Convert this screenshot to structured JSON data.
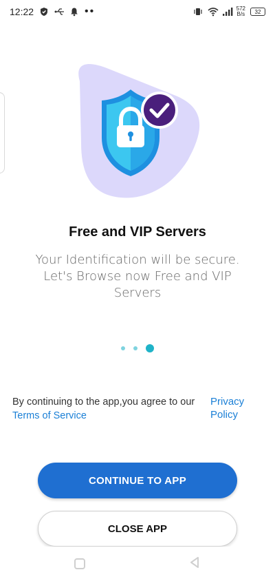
{
  "status_bar": {
    "time": "12:22",
    "net_speed_value": "572",
    "net_speed_unit": "B/s",
    "battery": "32"
  },
  "icons": {
    "status_left": [
      "shield-check-icon",
      "usb-icon",
      "bell-icon",
      "more-dots-icon"
    ],
    "status_right": [
      "vibrate-icon",
      "wifi-icon",
      "signal-icon",
      "battery-icon"
    ]
  },
  "onboarding": {
    "title": "Free and VIP Servers",
    "subtitle": "Your Identification will be secure. Let's Browse now Free and VIP Servers",
    "page_count": 3,
    "current_page": 3
  },
  "terms": {
    "text": "By continuing to the app,you agree to our",
    "privacy_link": "Privacy Policy",
    "terms_link": "Terms of Service"
  },
  "buttons": {
    "continue_label": "CONTINUE TO APP",
    "close_label": "CLOSE APP"
  },
  "colors": {
    "primary": "#1f6fd1",
    "link": "#1a7fd6",
    "pager_active": "#1fb3c8",
    "pager_inactive": "#7fd3df",
    "blob": "#dcd8fb",
    "badge": "#4a1f7c"
  }
}
